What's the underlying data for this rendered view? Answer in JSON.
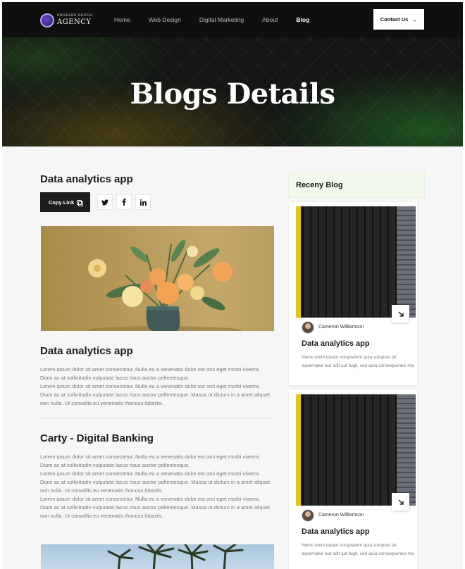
{
  "header": {
    "logo": {
      "small": "BRISBANE DIGITAL",
      "big": "AGENCY"
    },
    "nav": [
      {
        "label": "Home",
        "active": false
      },
      {
        "label": "Web Design",
        "active": false
      },
      {
        "label": "Digital Marketing",
        "active": false
      },
      {
        "label": "About",
        "active": false
      },
      {
        "label": "Blog",
        "active": true
      }
    ],
    "contact_label": "Contact Us"
  },
  "hero": {
    "title": "Blogs Details"
  },
  "post": {
    "title": "Data analytics app",
    "copy_link_label": "Copy Link",
    "social_icons": [
      "twitter-icon",
      "facebook-icon",
      "linkedin-icon"
    ]
  },
  "sections": [
    {
      "title": "Data analytics app",
      "paragraphs": [
        "Lorem ipsum dolor sit amet consectetur. Nulla eu a venenatis dolor est orci eget morbi viverra. Diam ac at sollicitudin vulputate lacus risus auctor pellentesque.",
        "Lorem ipsum dolor sit amet consectetur. Nulla eu a venenatis dolor est orci eget morbi viverra. Diam ac at sollicitudin vulputate lacus risus auctor pellentesque. Massa ut dictum in a amet aliquet non nulla. Ut convallis eu venenatis rhoncus lobortis."
      ]
    },
    {
      "title": "Carty - Digital Banking",
      "paragraphs": [
        "Lorem ipsum dolor sit amet consectetur. Nulla eu a venenatis dolor est orci eget morbi viverra. Diam ac at sollicitudin vulputate lacus risus auctor pellentesque.",
        "Lorem ipsum dolor sit amet consectetur. Nulla eu a venenatis dolor est orci eget morbi viverra. Diam ac at sollicitudin vulputate lacus risus auctor pellentesque. Massa ut dictum in a amet aliquet non nulla. Ut convallis eu venenatis rhoncus lobortis.",
        "Lorem ipsum dolor sit amet consectetur. Nulla eu a venenatis dolor est orci eget morbi viverra. Diam ac at sollicitudin vulputate lacus risus auctor pellentesque. Massa ut dictum in a amet aliquet non nulla. Ut convallis eu venenatis rhoncus lobortis."
      ]
    }
  ],
  "sidebar": {
    "title": "Receny Blog",
    "cards": [
      {
        "author": "Cameron Williamson",
        "title": "Data analytics app",
        "desc": "Nemo enim ipsam voluptatem quia voluptas sit aspernatur aut odit aut fugit, sed quia consequuntur ma"
      },
      {
        "author": "Cameron Williamson",
        "title": "Data analytics app",
        "desc": "Nemo enim ipsam voluptatem quia voluptas sit aspernatur aut odit aut fugit, sed quia consequuntur ma"
      }
    ]
  },
  "colors": {
    "nav_bg": "#0f0f0f",
    "accent_yellow": "#e3c22a",
    "sidebar_head_bg": "#f3f8ec",
    "dark_button": "#1d1d1d"
  }
}
